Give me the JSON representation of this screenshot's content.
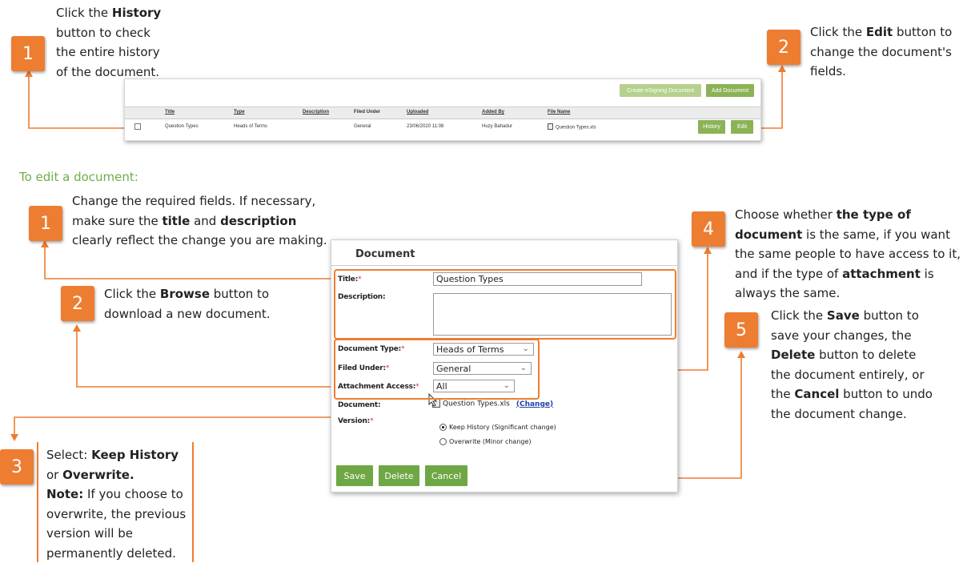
{
  "top_callouts": {
    "c1": {
      "badge": "1",
      "pre": "Click the ",
      "bold": "History",
      "post": " button to check the entire history of the document."
    },
    "c2": {
      "badge": "2",
      "pre": "Click the ",
      "bold": "Edit",
      "post": " button to change the document's fields."
    }
  },
  "grid": {
    "buttons": {
      "create_esigning": "Create eSigning Document",
      "add_document": "Add Document",
      "history": "History",
      "edit": "Edit"
    },
    "columns": [
      "Title",
      "Type",
      "Description",
      "Filed Under",
      "Uploaded",
      "Added By",
      "File Name"
    ],
    "row": {
      "title": "Question Types",
      "type": "Heads of Terms",
      "description": "",
      "filed_under": "General",
      "uploaded": "23/06/2020 11:08",
      "added_by": "Huzy Bahadur",
      "file_name": "Question Types.xls"
    }
  },
  "section_heading": "To edit a document:",
  "steps": {
    "s1": {
      "badge": "1",
      "pre": "Change the required fields. If necessary, make sure the ",
      "b1": "title",
      "mid": " and ",
      "b2": "description",
      "post": " clearly reflect the change you are making."
    },
    "s2": {
      "badge": "2",
      "pre": "Click the ",
      "bold": "Browse",
      "post": " button to download a new document."
    },
    "s3": {
      "badge": "3",
      "pre": "Select: ",
      "b1": "Keep History",
      "mid": " or ",
      "b2": "Overwrite.",
      "note_label": "Note:",
      "note": "  If you choose to overwrite, the previous version will be permanently deleted."
    },
    "s4": {
      "badge": "4",
      "pre": "Choose whether ",
      "b1": "the type of document",
      "mid1": " is the same, if you want the same people to have access to it, and if the type of ",
      "b2": "attachment",
      "post": " is always the same."
    },
    "s5": {
      "badge": "5",
      "pre": "Click the ",
      "b1": "Save",
      "mid1": " button to save your changes, the ",
      "b2": "Delete",
      "mid2": " button to delete the document entirely, or the ",
      "b3": "Cancel",
      "post": " button to undo the document change."
    }
  },
  "document_form": {
    "heading": "Document",
    "labels": {
      "title": "Title:",
      "description": "Description:",
      "document_type": "Document Type:",
      "filed_under": "Filed Under:",
      "attachment_access": "Attachment Access:",
      "document": "Document:",
      "version": "Version:"
    },
    "required_mark": "*",
    "values": {
      "title": "Question Types",
      "description": "",
      "document_type": "Heads of Terms",
      "filed_under": "General",
      "attachment_access": "All",
      "document_file": "Question Types.xls",
      "change_link": "(Change)"
    },
    "version_options": [
      {
        "label": "Keep History (Significant change)",
        "selected": true
      },
      {
        "label": "Overwrite (Minor change)",
        "selected": false
      }
    ],
    "buttons": {
      "save": "Save",
      "delete": "Delete",
      "cancel": "Cancel"
    }
  },
  "colors": {
    "accent_orange": "#ed7d31",
    "button_green": "#6fa744",
    "heading_green": "#70ad47"
  }
}
